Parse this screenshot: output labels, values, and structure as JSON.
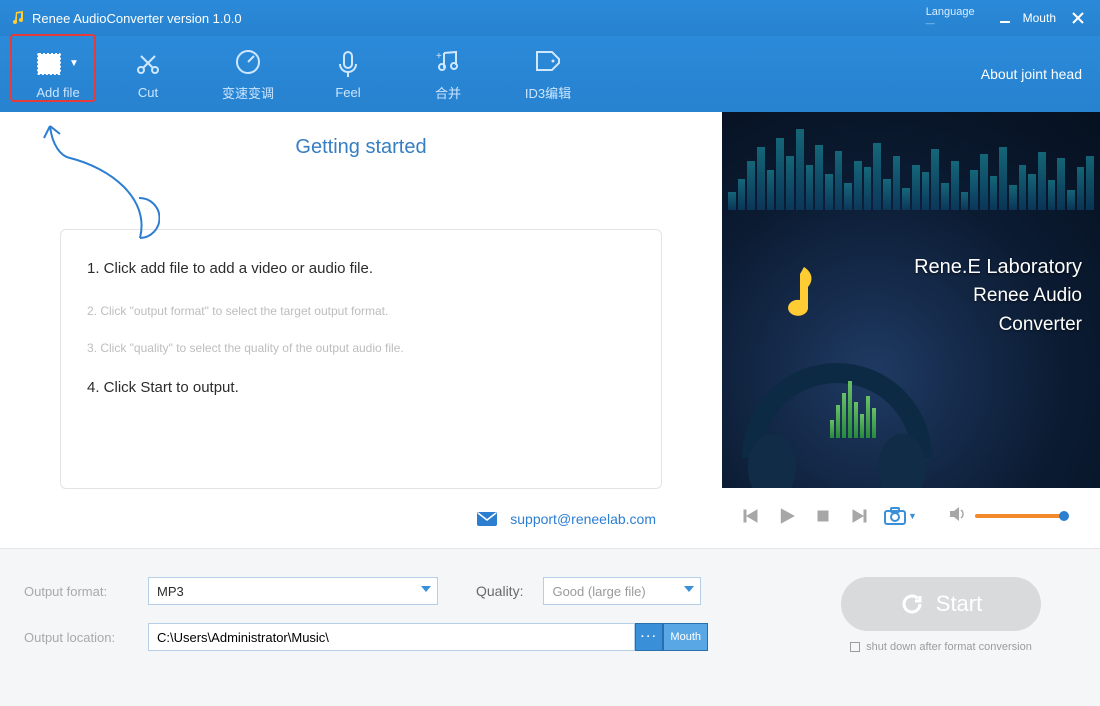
{
  "titlebar": {
    "title": "Renee AudioConverter version 1.0.0",
    "language_label": "Language",
    "mouth": "Mouth"
  },
  "toolbar": {
    "add_file": "Add file",
    "cut": "Cut",
    "speed": "变速变调",
    "record": "Feel",
    "merge": "合并",
    "id3": "ID3编辑",
    "about": "About joint head"
  },
  "getting_started": {
    "heading": "Getting started",
    "step1": "1. Click add file to add a video or audio file.",
    "step2": "2. Click \"output format\" to select the target output format.",
    "step3": "3. Click \"quality\" to select the quality of the output audio file.",
    "step4": "4. Click Start to output."
  },
  "support": {
    "email": "support@reneelab.com"
  },
  "preview": {
    "line1": "Rene.E Laboratory",
    "line2": "Renee Audio",
    "line3": "Converter"
  },
  "bottom": {
    "output_format_label": "Output format:",
    "output_format_value": "MP3",
    "quality_label": "Quality:",
    "quality_value": "Good (large file)",
    "output_location_label": "Output location:",
    "output_location_value": "C:\\Users\\Administrator\\Music\\",
    "browse": "···",
    "open": "Mouth",
    "start": "Start",
    "shutdown": "shut down after format conversion"
  }
}
